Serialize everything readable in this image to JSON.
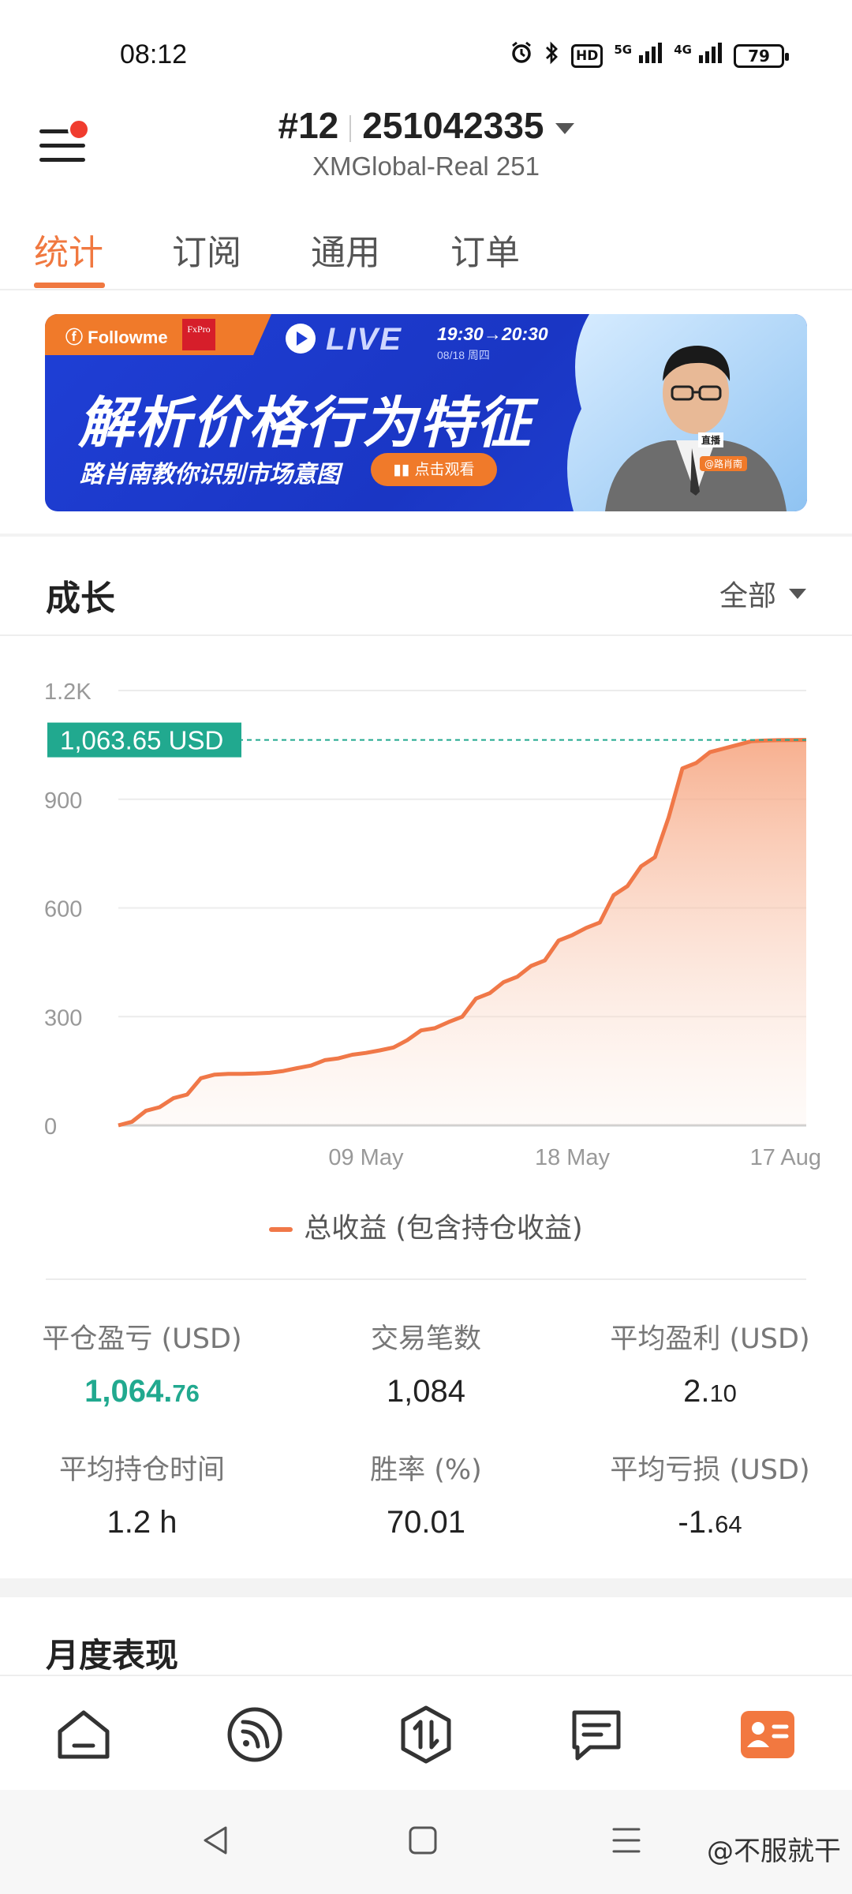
{
  "status_bar": {
    "time": "08:12",
    "hd": "HD",
    "net1": "5G",
    "net2": "4G",
    "battery": "79"
  },
  "header": {
    "account_num": "#12",
    "account_id": "251042335",
    "subtitle": "XMGlobal-Real 251"
  },
  "tabs": [
    {
      "label": "统计",
      "active": true
    },
    {
      "label": "订阅",
      "active": false
    },
    {
      "label": "通用",
      "active": false
    },
    {
      "label": "订单",
      "active": false
    }
  ],
  "banner": {
    "brand": "Followme",
    "partner": "FxPro",
    "live": "LIVE",
    "time": "19:30→20:30",
    "date": "08/18 周四",
    "headline": "解析价格行为特征",
    "subline": "路肖南教你识别市场意图",
    "button": "点击观看",
    "host_tag": "直播",
    "host_name": "@路肖南"
  },
  "growth": {
    "title": "成长",
    "range": "全部"
  },
  "chart_data": {
    "type": "area",
    "y_ticks": [
      "0",
      "300",
      "600",
      "900",
      "1.2K"
    ],
    "ylim": [
      0,
      1200
    ],
    "x_ticks": [
      {
        "label": "09 May",
        "x": 0.36
      },
      {
        "label": "18 May",
        "x": 0.66
      },
      {
        "label": "17 Aug",
        "x": 0.97
      }
    ],
    "current_label": "1,063.65 USD",
    "current_value": 1063.65,
    "series": [
      {
        "name": "总收益 (包含持仓收益)",
        "x": [
          0.0,
          0.02,
          0.04,
          0.06,
          0.08,
          0.1,
          0.12,
          0.14,
          0.16,
          0.18,
          0.2,
          0.22,
          0.24,
          0.26,
          0.28,
          0.3,
          0.32,
          0.34,
          0.36,
          0.38,
          0.4,
          0.42,
          0.44,
          0.46,
          0.48,
          0.5,
          0.52,
          0.54,
          0.56,
          0.58,
          0.6,
          0.62,
          0.64,
          0.66,
          0.68,
          0.7,
          0.72,
          0.74,
          0.76,
          0.78,
          0.8,
          0.82,
          0.84,
          0.86,
          0.88,
          0.9,
          0.92,
          0.94,
          0.96,
          0.98,
          1.0
        ],
        "values": [
          0,
          10,
          40,
          50,
          75,
          85,
          130,
          140,
          142,
          142,
          143,
          145,
          150,
          158,
          165,
          180,
          185,
          195,
          200,
          207,
          215,
          235,
          262,
          268,
          285,
          300,
          350,
          365,
          395,
          410,
          440,
          455,
          510,
          525,
          545,
          560,
          635,
          660,
          715,
          740,
          850,
          985,
          1000,
          1030,
          1040,
          1050,
          1060,
          1062,
          1063,
          1063.5,
          1063.65
        ]
      }
    ]
  },
  "legend": {
    "label": "总收益 (包含持仓收益)"
  },
  "stats": [
    {
      "label": "平仓盈亏 (USD)",
      "main": "1,064.",
      "small": "76",
      "green": true
    },
    {
      "label": "交易笔数",
      "main": "1,084",
      "small": "",
      "green": false
    },
    {
      "label": "平均盈利 (USD)",
      "main": "2.",
      "small": "10",
      "green": false
    },
    {
      "label": "平均持仓时间",
      "main": "1.2 h",
      "small": "",
      "green": false
    },
    {
      "label": "胜率 (%)",
      "main": "70.01",
      "small": "",
      "green": false
    },
    {
      "label": "平均亏损 (USD)",
      "main": "-1.",
      "small": "64",
      "green": false
    }
  ],
  "monthly": {
    "title": "月度表现"
  },
  "nav": [
    {
      "name": "home-icon",
      "active": false
    },
    {
      "name": "feed-icon",
      "active": false
    },
    {
      "name": "trade-icon",
      "active": false
    },
    {
      "name": "news-icon",
      "active": false
    },
    {
      "name": "profile-icon",
      "active": true
    }
  ],
  "watermark": "@不服就干",
  "colors": {
    "accent": "#f07840",
    "green": "#21a98f",
    "chart_line": "#f07848"
  }
}
